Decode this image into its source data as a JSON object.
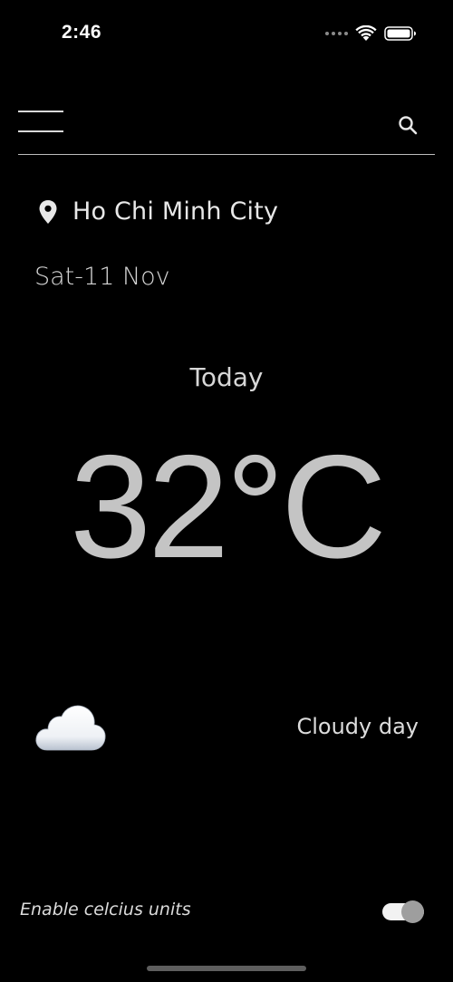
{
  "status_bar": {
    "time": "2:46",
    "icons": [
      "signal-dots-icon",
      "wifi-icon",
      "battery-icon"
    ]
  },
  "header": {
    "menu_icon": "hamburger-menu-icon",
    "search_icon": "search-icon"
  },
  "location": {
    "icon": "map-pin-icon",
    "city": "Ho Chi Minh City"
  },
  "date": "Sat-11 Nov",
  "day_label": "Today",
  "temperature": "32°C",
  "weather": {
    "icon": "cloud-icon",
    "condition": "Cloudy day"
  },
  "settings": {
    "celsius_label": "Enable celcius units",
    "celsius_enabled": true
  },
  "colors": {
    "background": "#000000",
    "text": "#d7d7d7",
    "temperature": "#c4c4c4",
    "toggle_track": "#f2f2f2",
    "toggle_thumb": "#9e9e9e"
  }
}
